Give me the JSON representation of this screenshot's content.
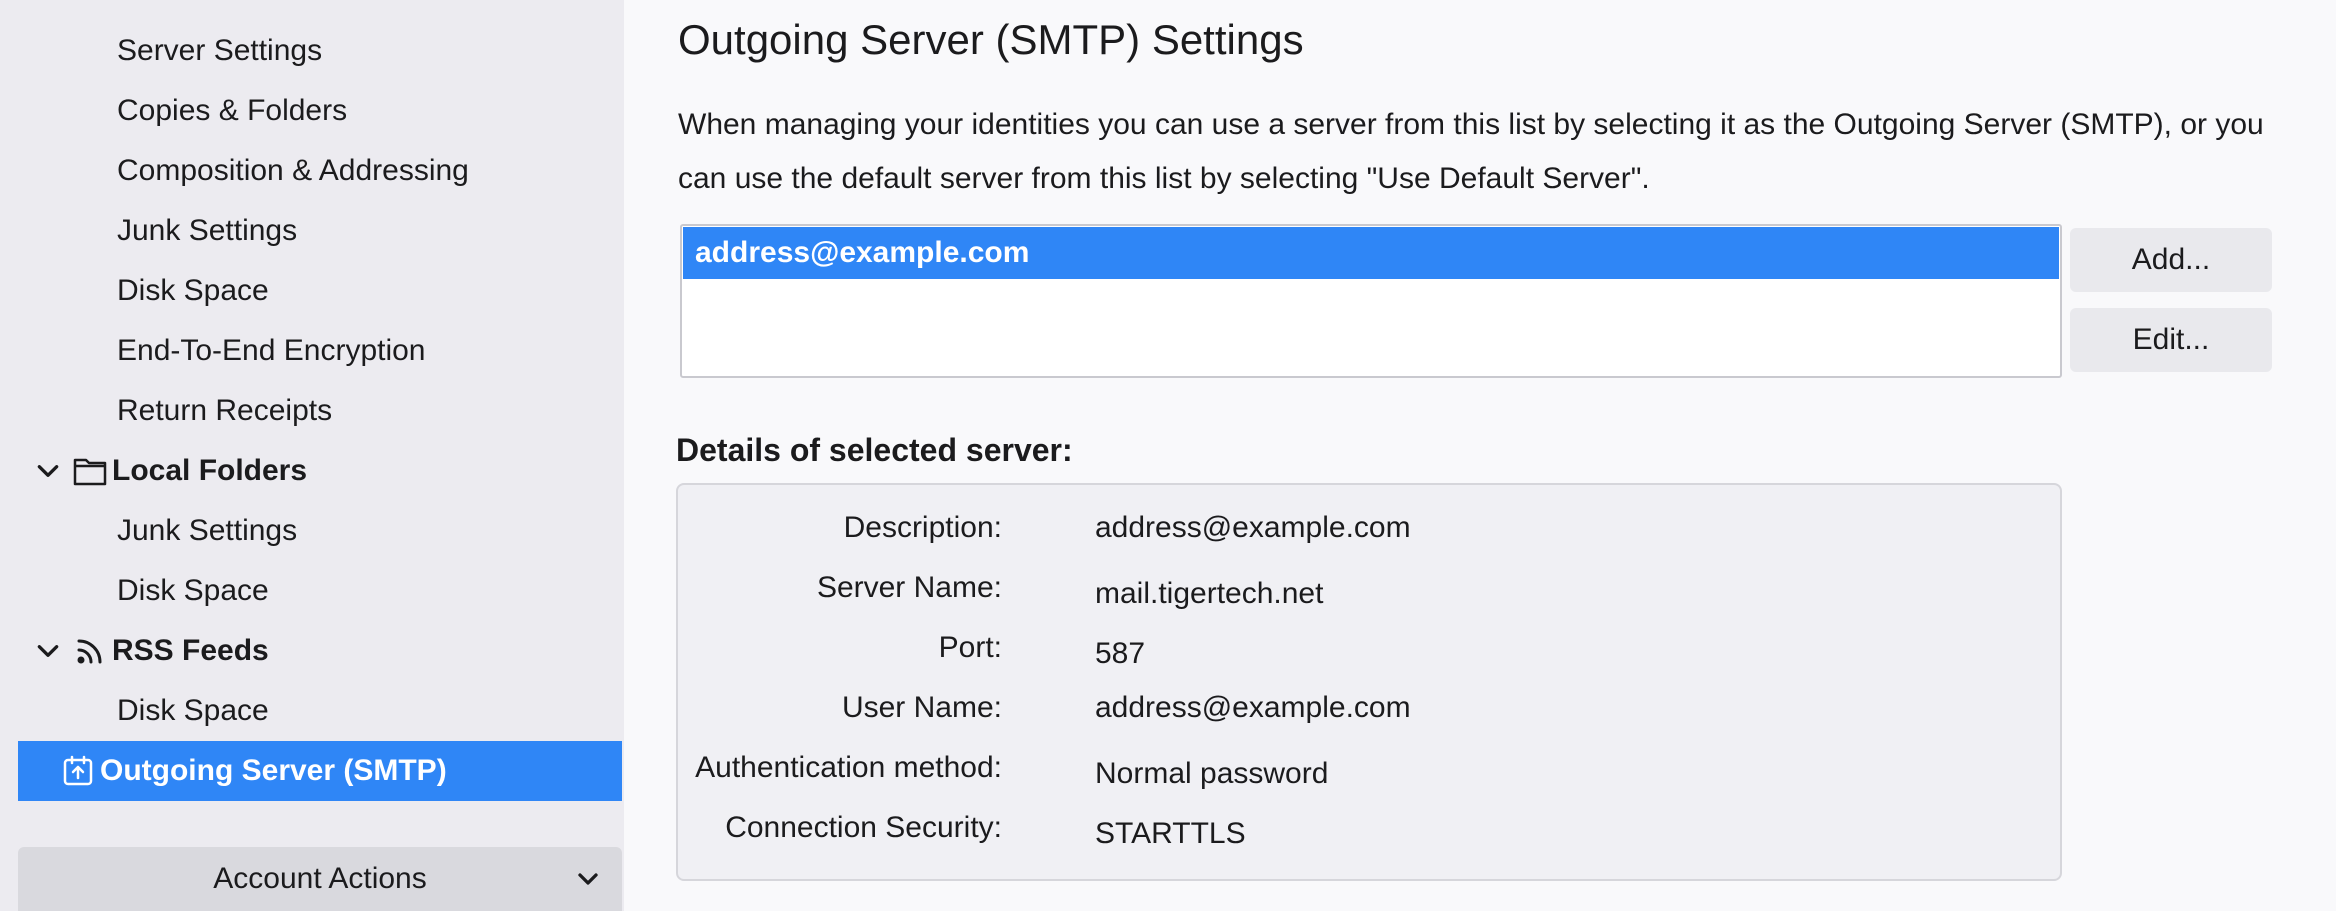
{
  "sidebar": {
    "items": [
      {
        "label": "Server Settings"
      },
      {
        "label": "Copies & Folders"
      },
      {
        "label": "Composition & Addressing"
      },
      {
        "label": "Junk Settings"
      },
      {
        "label": "Disk Space"
      },
      {
        "label": "End-To-End Encryption"
      },
      {
        "label": "Return Receipts"
      }
    ],
    "local_folders": {
      "label": "Local Folders",
      "items": [
        {
          "label": "Junk Settings"
        },
        {
          "label": "Disk Space"
        }
      ]
    },
    "rss_feeds": {
      "label": "RSS Feeds",
      "items": [
        {
          "label": "Disk Space"
        }
      ]
    },
    "selected": {
      "label": "Outgoing Server (SMTP)"
    },
    "account_actions": "Account Actions"
  },
  "main": {
    "title": "Outgoing Server (SMTP) Settings",
    "description": "When managing your identities you can use a server from this list by selecting it as the Outgoing Server (SMTP), or you can use the default server from this list by selecting \"Use Default Server\".",
    "server_list": [
      "address@example.com"
    ],
    "buttons": {
      "add": "Add...",
      "edit": "Edit..."
    },
    "details_heading": "Details of selected server:",
    "details": {
      "description": {
        "label": "Description:",
        "value": "address@example.com"
      },
      "server_name": {
        "label": "Server Name:",
        "value": "mail.tigertech.net"
      },
      "port": {
        "label": "Port:",
        "value": "587"
      },
      "user_name": {
        "label": "User Name:",
        "value": "address@example.com"
      },
      "auth_method": {
        "label": "Authentication method:",
        "value": "Normal password"
      },
      "connection_security": {
        "label": "Connection Security:",
        "value": "STARTTLS"
      }
    }
  },
  "colors": {
    "accent": "#2f86f6",
    "sidebar_bg": "#ecebf0"
  }
}
